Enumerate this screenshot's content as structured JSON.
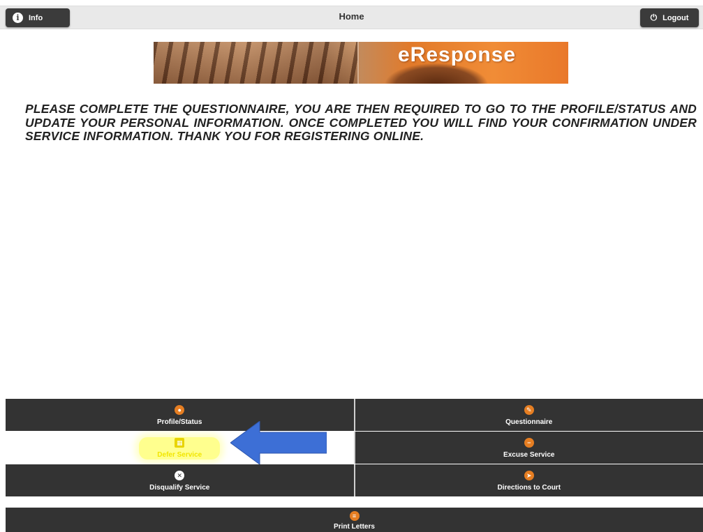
{
  "header": {
    "info_label": "Info",
    "title": "Home",
    "logout_label": "Logout"
  },
  "banner": {
    "brand": "eResponse"
  },
  "message": "PLEASE COMPLETE THE QUESTIONNAIRE, YOU ARE THEN REQUIRED TO GO TO THE PROFILE/STATUS AND UPDATE YOUR PERSONAL INFORMATION. ONCE COMPLETED YOU WILL FIND YOUR CONFIRMATION UNDER SERVICE INFORMATION. THANK YOU FOR REGISTERING ONLINE.",
  "menu": {
    "rows": [
      [
        {
          "label": "Profile/Status",
          "icon": "user-icon"
        },
        {
          "label": "Questionnaire",
          "icon": "pencil-icon"
        }
      ],
      [
        {
          "label": "Defer Service",
          "icon": "calendar-icon"
        },
        {
          "label": "Excuse Service",
          "icon": "minus-circle-icon"
        }
      ],
      [
        {
          "label": "Disqualify Service",
          "icon": "x-circle-icon"
        },
        {
          "label": "Directions to Court",
          "icon": "navigation-arrow-icon"
        }
      ]
    ],
    "print_label": "Print Letters",
    "print_icon": "list-icon"
  },
  "colors": {
    "header_bg": "#e9e9e9",
    "button_bg": "#3b3b3b",
    "menu_bg": "#333333",
    "icon_accent": "#e67e22",
    "highlight": "#ffff33",
    "arrow": "#3d6fd6"
  }
}
